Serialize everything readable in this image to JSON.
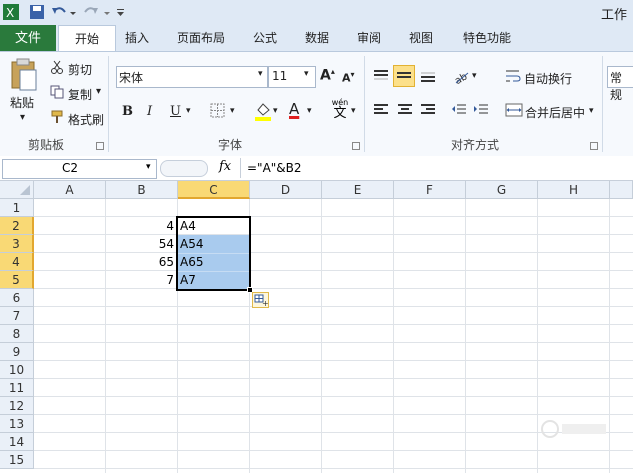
{
  "title": "工作",
  "tabs": {
    "file": "文件",
    "items": [
      "开始",
      "插入",
      "页面布局",
      "公式",
      "数据",
      "审阅",
      "视图",
      "特色功能"
    ]
  },
  "clipboard": {
    "paste": "粘贴",
    "cut": "剪切",
    "copy": "复制",
    "format_painter": "格式刷",
    "label": "剪贴板"
  },
  "font": {
    "name": "宋体",
    "size": "11",
    "bold": "B",
    "italic": "I",
    "underline": "U",
    "font_color": "A",
    "wen": "wén",
    "wen_char": "文",
    "label": "字体"
  },
  "alignment": {
    "wrap": "自动换行",
    "merge": "合并后居中",
    "label": "对齐方式"
  },
  "number": {
    "format": "常规"
  },
  "formula_bar": {
    "name_box": "C2",
    "fx": "fx",
    "formula": "=\"A\"&B2"
  },
  "columns": [
    "A",
    "B",
    "C",
    "D",
    "E",
    "F",
    "G",
    "H"
  ],
  "rows": [
    "1",
    "2",
    "3",
    "4",
    "5",
    "6",
    "7",
    "8",
    "9",
    "10",
    "11",
    "12",
    "13",
    "14",
    "15"
  ],
  "cells": {
    "B2": "4",
    "B3": "54",
    "B4": "65",
    "B5": "7",
    "C2": "A4",
    "C3": "A54",
    "C4": "A65",
    "C5": "A7"
  },
  "colors": {
    "file_tab": "#2a7a3c",
    "selection": "#a9cbee",
    "active_header": "#f9d975"
  }
}
